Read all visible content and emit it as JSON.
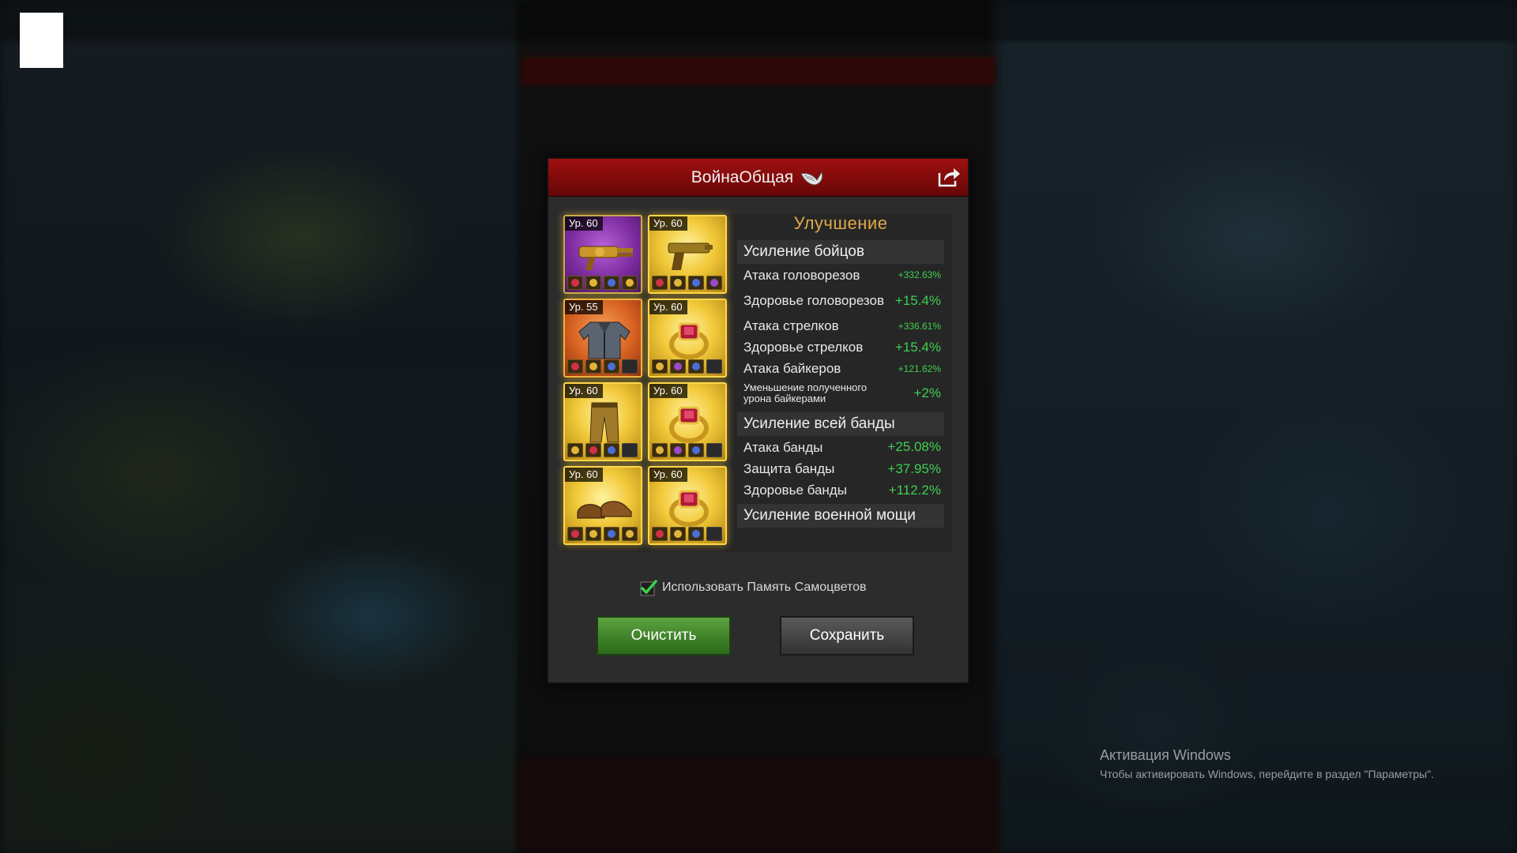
{
  "dialog": {
    "title": "ВойнаОбщая",
    "share_icon": "share-icon",
    "title_icon": "wing-icon"
  },
  "equipment": [
    {
      "level": "Ур. 60",
      "item": "gatling-gun",
      "rarity": "purple",
      "gems": [
        "red",
        "gold",
        "blue",
        "gold"
      ]
    },
    {
      "level": "Ур. 60",
      "item": "golden-pistol",
      "rarity": "gold",
      "gems": [
        "red",
        "gold",
        "blue",
        "purple"
      ]
    },
    {
      "level": "Ур. 55",
      "item": "leather-jacket",
      "rarity": "orange",
      "gems": [
        "red",
        "gold",
        "blue",
        "empty"
      ]
    },
    {
      "level": "Ур. 60",
      "item": "ruby-ring",
      "rarity": "gold",
      "gems": [
        "gold",
        "purple",
        "blue",
        "empty"
      ]
    },
    {
      "level": "Ур. 60",
      "item": "golden-pants",
      "rarity": "gold",
      "gems": [
        "gold",
        "red",
        "blue",
        "empty"
      ]
    },
    {
      "level": "Ур. 60",
      "item": "ruby-ring",
      "rarity": "gold",
      "gems": [
        "gold",
        "purple",
        "blue",
        "empty"
      ]
    },
    {
      "level": "Ур. 60",
      "item": "leather-shoes",
      "rarity": "gold",
      "gems": [
        "red",
        "gold",
        "blue",
        "gold"
      ]
    },
    {
      "level": "Ур. 60",
      "item": "ruby-ring",
      "rarity": "gold",
      "gems": [
        "red",
        "gold",
        "blue",
        "empty"
      ]
    }
  ],
  "stats": {
    "heading": "Улучшение",
    "section_fighters": "Усиление бойцов",
    "fighter_rows": [
      {
        "name": "Атака головорезов",
        "value": "+332.63%",
        "size": "s"
      },
      {
        "name": "Здоровье головорезов",
        "value": "+15.4%",
        "size": "l"
      },
      {
        "name": "Атака стрелков",
        "value": "+336.61%",
        "size": "s"
      },
      {
        "name": "Здоровье стрелков",
        "value": "+15.4%",
        "size": "l"
      },
      {
        "name": "Атака байкеров",
        "value": "+121.62%",
        "size": "s"
      },
      {
        "name": "Уменьшение полученного урона байкерами",
        "value": "+2%",
        "size": "l"
      }
    ],
    "section_gang": "Усиление всей банды",
    "gang_rows": [
      {
        "name": "Атака банды",
        "value": "+25.08%"
      },
      {
        "name": "Защита банды",
        "value": "+37.95%"
      },
      {
        "name": "Здоровье банды",
        "value": "+112.2%"
      }
    ],
    "section_military": "Усиление военной мощи"
  },
  "options": {
    "use_gem_memory": "Использовать Память Самоцветов",
    "use_gem_memory_checked": true
  },
  "buttons": {
    "clear": "Очистить",
    "save": "Сохранить"
  },
  "watermark": {
    "title": "Активация Windows",
    "subtitle": "Чтобы активировать Windows, перейдите в раздел \"Параметры\"."
  },
  "colors": {
    "header_red": "#8e0c0c",
    "accent_gold": "#e0a94a",
    "value_green": "#3fcf52",
    "clear_green": "#3f8229"
  }
}
